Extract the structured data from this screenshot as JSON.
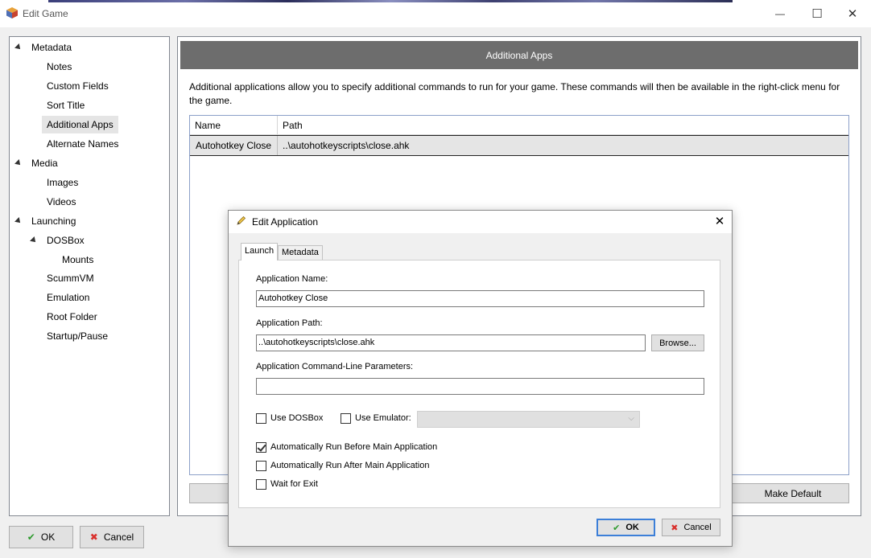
{
  "window": {
    "title": "Edit Game",
    "minimize_glyph": "—",
    "maximize_glyph": "☐",
    "close_glyph": "✕"
  },
  "tree": {
    "items": [
      {
        "label": "Metadata",
        "expanded": true
      },
      {
        "label": "Notes"
      },
      {
        "label": "Custom Fields"
      },
      {
        "label": "Sort Title"
      },
      {
        "label": "Additional Apps",
        "selected": true
      },
      {
        "label": "Alternate Names"
      },
      {
        "label": "Media",
        "expanded": true
      },
      {
        "label": "Images"
      },
      {
        "label": "Videos"
      },
      {
        "label": "Launching",
        "expanded": true
      },
      {
        "label": "DOSBox",
        "expanded": true
      },
      {
        "label": "Mounts"
      },
      {
        "label": "ScummVM"
      },
      {
        "label": "Emulation"
      },
      {
        "label": "Root Folder"
      },
      {
        "label": "Startup/Pause"
      }
    ]
  },
  "panel": {
    "header": "Additional Apps",
    "description": "Additional applications allow you to specify additional commands to run for your game.  These commands will then be available in the right-click menu for the game.",
    "columns": [
      "Name",
      "Path"
    ],
    "rows": [
      {
        "name": "Autohotkey Close",
        "path": "..\\autohotkeyscripts\\close.ahk"
      }
    ],
    "make_default_label": "Make Default"
  },
  "footer": {
    "ok_label": "OK",
    "cancel_label": "Cancel"
  },
  "dialog": {
    "title": "Edit Application",
    "close_glyph": "✕",
    "tabs": [
      "Launch",
      "Metadata"
    ],
    "active_tab": "Launch",
    "app_name_label": "Application Name:",
    "app_name_value": "Autohotkey Close",
    "app_path_label": "Application Path:",
    "app_path_value": "..\\autohotkeyscripts\\close.ahk",
    "browse_label": "Browse...",
    "cmdline_label": "Application Command-Line Parameters:",
    "cmdline_value": "",
    "use_dosbox_label": "Use DOSBox",
    "use_dosbox_checked": false,
    "use_emulator_label": "Use Emulator:",
    "use_emulator_checked": false,
    "run_before_label": "Automatically Run Before Main Application",
    "run_before_checked": true,
    "run_after_label": "Automatically Run After Main Application",
    "run_after_checked": false,
    "wait_exit_label": "Wait for Exit",
    "wait_exit_checked": false,
    "ok_label": "OK",
    "cancel_label": "Cancel"
  },
  "colors": {
    "header_bg": "#6d6d6d",
    "ok_check": "#2e9b2e",
    "cancel_x": "#d9302c",
    "focus_border": "#3c7fd8"
  }
}
